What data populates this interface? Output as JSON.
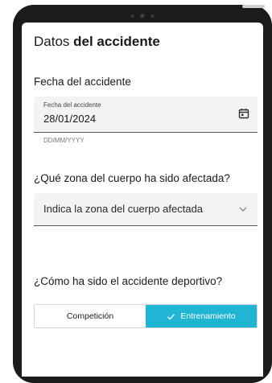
{
  "header": {
    "title_prefix": "Datos ",
    "title_bold": "del accidente"
  },
  "date_section": {
    "label": "Fecha del accidente",
    "field_label": "Fecha del accidente",
    "field_value": "28/01/2024",
    "hint": "DD/MM/YYYY",
    "icon": "calendar-icon"
  },
  "body_zone_section": {
    "label": "¿Qué zona del cuerpo ha sido afectada?",
    "select_value": "Indica la zona del cuerpo afectada",
    "icon": "chevron-down-icon"
  },
  "accident_type_section": {
    "label": "¿Cómo ha sido el accidente deportivo?",
    "options": [
      {
        "label": "Competición",
        "selected": false
      },
      {
        "label": "Entrenamiento",
        "selected": true
      }
    ],
    "selected_icon": "check-icon"
  },
  "colors": {
    "accent": "#1fb5d3",
    "field_background": "#f3f3f3",
    "device_frame": "#1b1b1b"
  }
}
